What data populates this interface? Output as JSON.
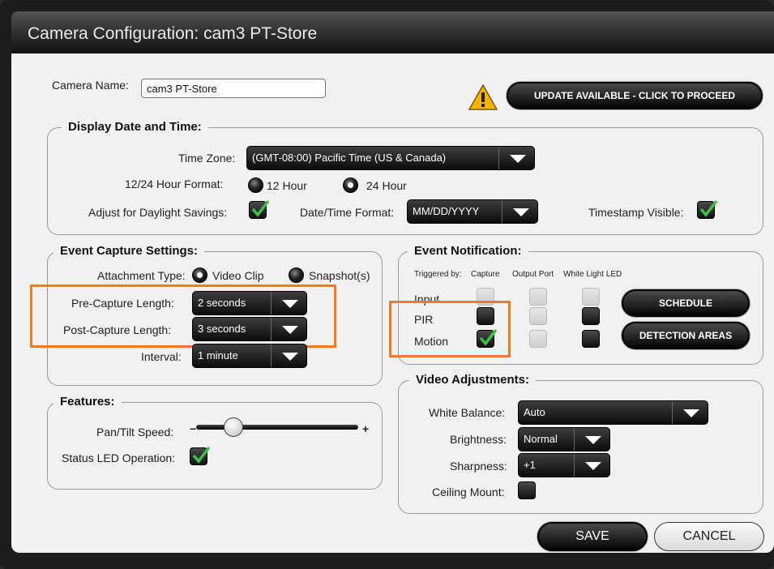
{
  "window": {
    "title": "Camera Configuration: cam3 PT-Store"
  },
  "camera_name": {
    "label": "Camera Name:",
    "value": "cam3 PT-Store"
  },
  "update_button": "UPDATE AVAILABLE - CLICK TO PROCEED",
  "datetime": {
    "title": "Display Date and Time:",
    "time_zone_label": "Time Zone:",
    "time_zone_value": "(GMT-08:00) Pacific Time (US & Canada)",
    "hour_format_label": "12/24 Hour Format:",
    "hour12_label": "12 Hour",
    "hour24_label": "24 Hour",
    "hour_format_selected": "24 Hour",
    "daylight_label": "Adjust for Daylight Savings:",
    "daylight_checked": true,
    "dt_format_label": "Date/Time Format:",
    "dt_format_value": "MM/DD/YYYY",
    "timestamp_label": "Timestamp Visible:",
    "timestamp_checked": true
  },
  "event_capture": {
    "title": "Event Capture Settings:",
    "attachment_label": "Attachment Type:",
    "video_clip_label": "Video Clip",
    "snapshot_label": "Snapshot(s)",
    "attachment_selected": "Video Clip",
    "pre_label": "Pre-Capture Length:",
    "pre_value": "2 seconds",
    "post_label": "Post-Capture Length:",
    "post_value": "3 seconds",
    "interval_label": "Interval:",
    "interval_value": "1 minute"
  },
  "event_notification": {
    "title": "Event Notification:",
    "triggered_by": "Triggered by:",
    "col_capture": "Capture",
    "col_output": "Output Port",
    "col_led": "White Light LED",
    "rows": [
      {
        "label": "Input",
        "capture": "disabled",
        "output": "disabled",
        "led": "disabled"
      },
      {
        "label": "PIR",
        "capture": "unchecked",
        "output": "disabled",
        "led": "unchecked"
      },
      {
        "label": "Motion",
        "capture": "checked",
        "output": "disabled",
        "led": "unchecked"
      }
    ],
    "schedule_button": "SCHEDULE",
    "detection_button": "DETECTION AREAS"
  },
  "features": {
    "title": "Features:",
    "pan_tilt_label": "Pan/Tilt Speed:",
    "minus": "−",
    "plus": "+",
    "pan_tilt_level": 0.25,
    "status_led_label": "Status LED Operation:",
    "status_led_checked": true
  },
  "video": {
    "title": "Video Adjustments:",
    "wb_label": "White Balance:",
    "wb_value": "Auto",
    "brightness_label": "Brightness:",
    "brightness_value": "Normal",
    "sharpness_label": "Sharpness:",
    "sharpness_value": "+1",
    "ceiling_label": "Ceiling Mount:",
    "ceiling_checked": false
  },
  "footer": {
    "save": "SAVE",
    "cancel": "CANCEL"
  },
  "colors": {
    "highlight": "#f07a2a",
    "check": "#3fbf4a"
  }
}
